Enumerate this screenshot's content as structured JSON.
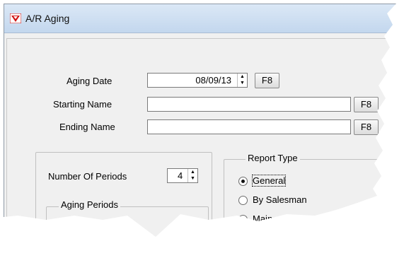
{
  "window": {
    "title": "A/R Aging",
    "icon": "app-logo-icon"
  },
  "form": {
    "aging_date_label": "Aging Date",
    "aging_date_value": "08/09/13",
    "aging_date_lookup": "F8",
    "starting_name_label": "Starting  Name",
    "starting_name_value": "",
    "starting_lookup": "F8",
    "ending_name_label": "Ending  Name",
    "ending_name_value": "",
    "ending_lookup": "F8"
  },
  "periods": {
    "number_label": "Number Of  Periods",
    "number_value": "4",
    "aging_periods_legend": "Aging Periods"
  },
  "report_type": {
    "legend": "Report Type",
    "options": [
      {
        "label": "General",
        "selected": true
      },
      {
        "label": "By Salesman",
        "selected": false
      },
      {
        "label": "Main",
        "selected": false
      }
    ]
  }
}
